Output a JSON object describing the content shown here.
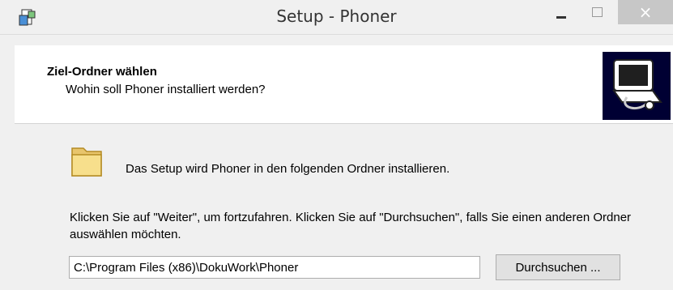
{
  "window": {
    "title": "Setup - Phoner",
    "buttons": {
      "minimize": "minimize-icon",
      "maximize": "maximize-icon",
      "close": "×"
    }
  },
  "header": {
    "title": "Ziel-Ordner wählen",
    "subtitle": "Wohin soll Phoner installiert werden?"
  },
  "content": {
    "info": "Das Setup wird Phoner in den folgenden Ordner installieren.",
    "instructions": "Klicken Sie auf \"Weiter\", um fortzufahren. Klicken Sie auf \"Durchsuchen\", falls Sie einen anderen Ordner auswählen möchten.",
    "path_value": "C:\\Program Files (x86)\\DokuWork\\Phoner",
    "browse_label": "Durchsuchen ..."
  },
  "colors": {
    "header_bg": "#ffffff",
    "window_bg": "#f0f0f0",
    "wizard_image_bg": "#000033"
  }
}
